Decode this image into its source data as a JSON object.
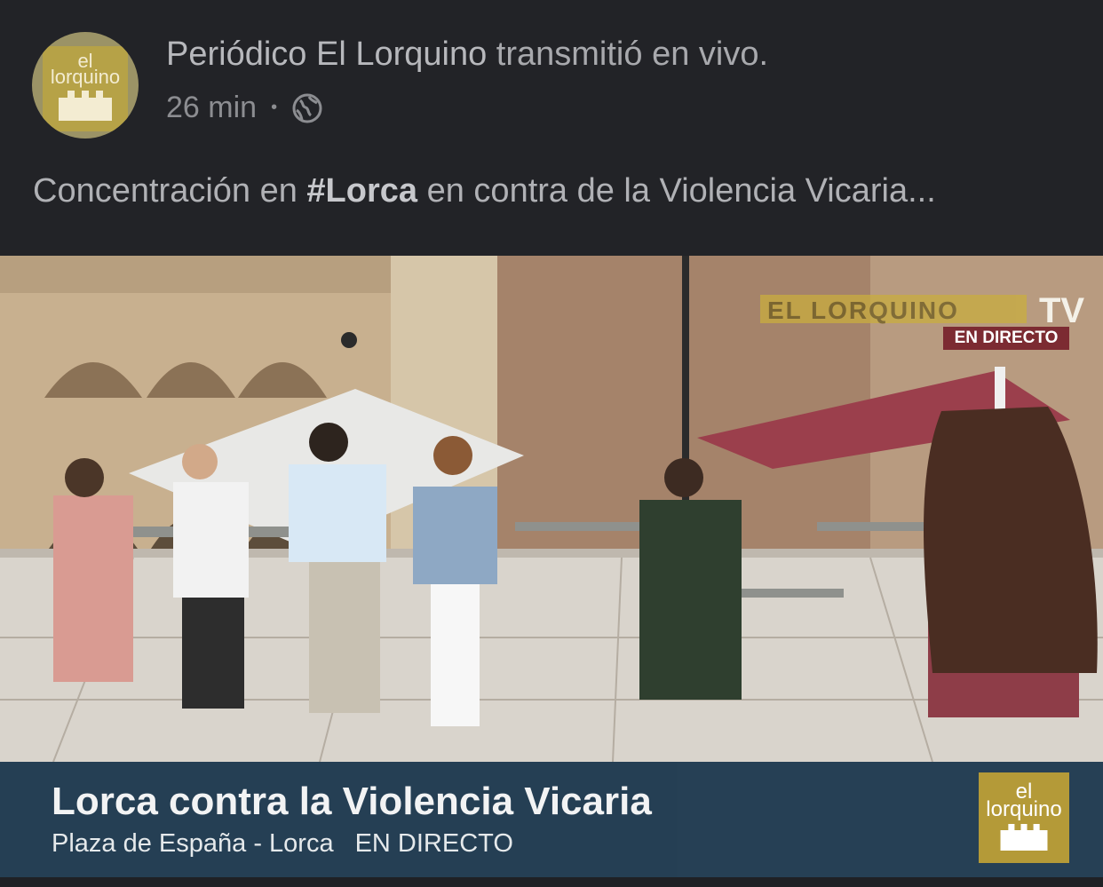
{
  "post": {
    "page_name": "Periódico El Lorquino",
    "action_text": "transmitió en vivo.",
    "time": "26 min",
    "separator": "•",
    "privacy_icon": "globe-icon",
    "caption_prefix": "Concentración en ",
    "caption_hashtag": "#Lorca",
    "caption_suffix": " en contra de la Violencia Vicaria..."
  },
  "avatar": {
    "logo_text_line1": "el",
    "logo_text_line2": "lorquino"
  },
  "video": {
    "brand_overlay": "EL LORQUINO",
    "tv_label": "TV",
    "live_badge": "EN DIRECTO",
    "lower_third_title": "Lorca contra la Violencia Vicaria",
    "lower_third_location": "Plaza de España - Lorca",
    "lower_third_live": "EN DIRECTO",
    "corner_logo_line1": "el",
    "corner_logo_line2": "lorquino"
  },
  "colors": {
    "background": "#222327",
    "lower_third": "#1f3a52",
    "logo_gold": "#b49a38",
    "badge_red": "#7c2b32"
  }
}
